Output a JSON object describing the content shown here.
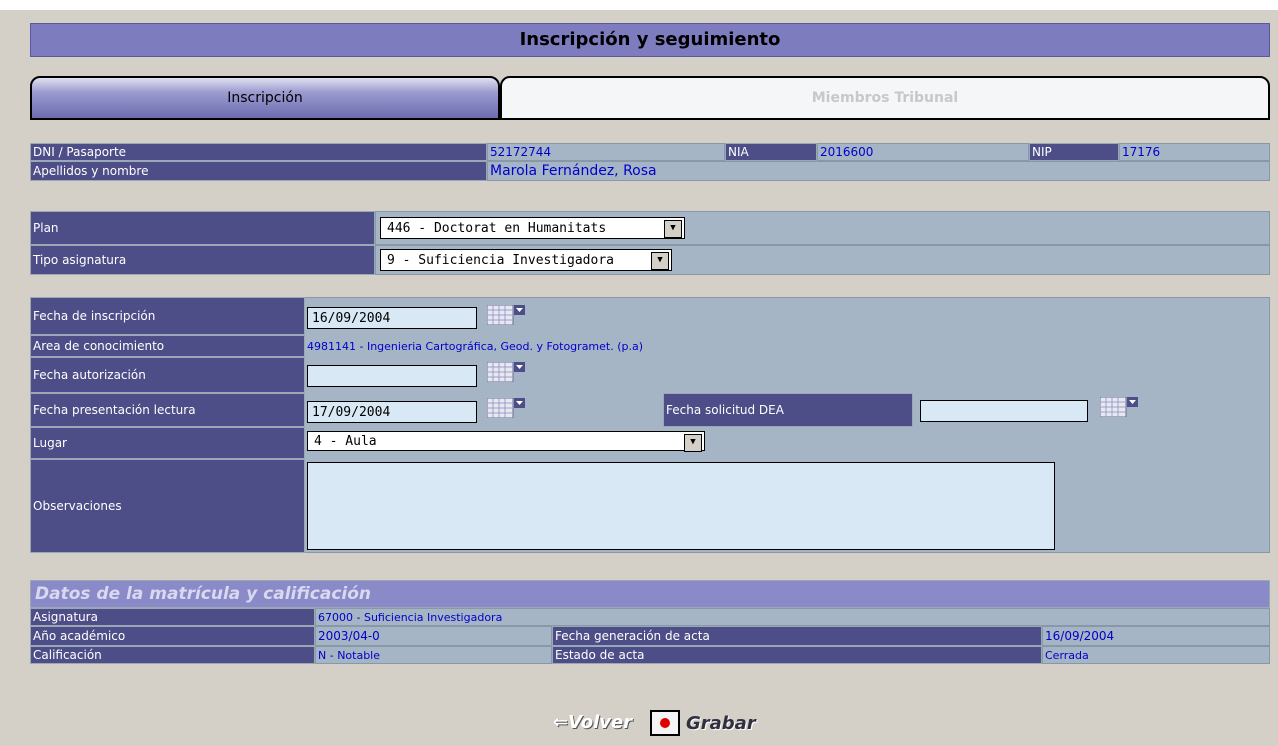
{
  "page": {
    "title": "Inscripción y seguimiento"
  },
  "tabs": [
    {
      "label": "Inscripción",
      "active": true
    },
    {
      "label": "Miembros Tribunal",
      "active": false
    }
  ],
  "student": {
    "dni_label": "DNI / Pasaporte",
    "dni_value": "52172744",
    "nia_label": "NIA",
    "nia_value": "2016600",
    "nip_label": "NIP",
    "nip_value": "17176",
    "name_label": "Apellidos y nombre",
    "name_value": "Marola Fernández, Rosa"
  },
  "plan": {
    "plan_label": "Plan",
    "plan_value": "446 - Doctorat en Humanitats",
    "tipo_label": "Tipo asignatura",
    "tipo_value": "9 - Suficiencia Investigadora"
  },
  "inscription": {
    "fecha_insc_label": "Fecha de inscripción",
    "fecha_insc_value": "16/09/2004",
    "area_label": "Area de conocimiento",
    "area_value": "4981141 -  Ingenieria Cartográfica, Geod. y Fotogramet. (p.a)",
    "fecha_aut_label": "Fecha autorización",
    "fecha_aut_value": "",
    "fecha_pres_label": "Fecha presentación lectura",
    "fecha_pres_value": "17/09/2004",
    "fecha_dea_label": "Fecha solicitud DEA",
    "fecha_dea_value": "",
    "lugar_label": "Lugar",
    "lugar_value": "4 - Aula",
    "obs_label": "Observaciones",
    "obs_value": ""
  },
  "matricula": {
    "section_title": "Datos de la matrícula y calificación",
    "asig_label": "Asignatura",
    "asig_value": "67000 - Suficiencia Investigadora",
    "anio_label": "Año académico",
    "anio_value": "2003/04-0",
    "fgen_label": "Fecha generación de acta",
    "fgen_value": "16/09/2004",
    "calif_label": "Calificación",
    "calif_value": "N - Notable",
    "estado_label": "Estado de acta",
    "estado_value": "Cerrada"
  },
  "actions": {
    "back_label": "Volver",
    "save_label": "Grabar"
  },
  "icons": {
    "calendar": "calendar-icon",
    "dropdown": "chevron-down-icon",
    "record": "record-icon",
    "back": "arrow-left-icon"
  },
  "colors": {
    "label_bg": "#4d4d88",
    "value_bg": "#a5b5c5",
    "header_bg": "#7c7cbf",
    "value_text": "#0000cc"
  }
}
